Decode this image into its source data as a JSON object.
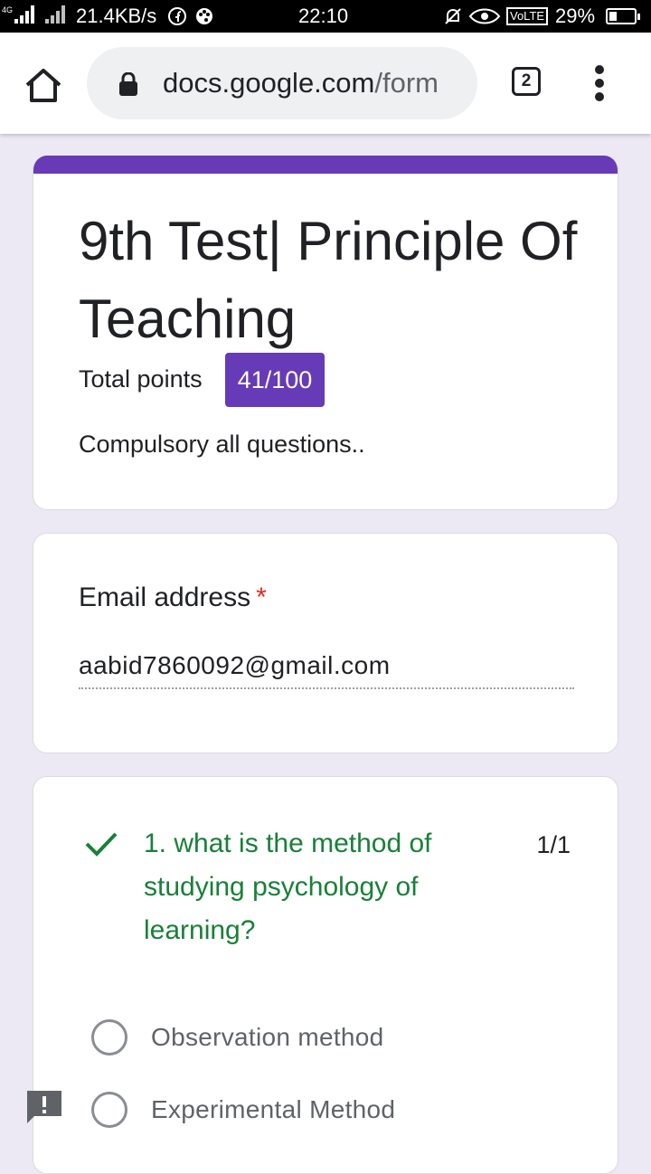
{
  "status_bar": {
    "network_label": "4G",
    "data_speed": "21.4KB/s",
    "time": "22:10",
    "volte": "VoLTE",
    "battery": "29%",
    "battery_level": 0.29
  },
  "browser": {
    "url_domain": "docs.google.com",
    "url_path": "/form",
    "tab_count": "2"
  },
  "form": {
    "title": "9th Test| Principle Of Teaching",
    "points_label": "Total points",
    "score": "41/100",
    "description": "Compulsory all questions..",
    "accent_color": "#673ab7"
  },
  "email": {
    "label": "Email address",
    "required_mark": "*",
    "value": "aabid7860092@gmail.com"
  },
  "question": {
    "text": "1. what is the method of studying psychology of learning?",
    "score": "1/1",
    "correct_color": "#188038",
    "options": [
      {
        "label": "Observation method"
      },
      {
        "label": "Experimental Method"
      }
    ]
  }
}
